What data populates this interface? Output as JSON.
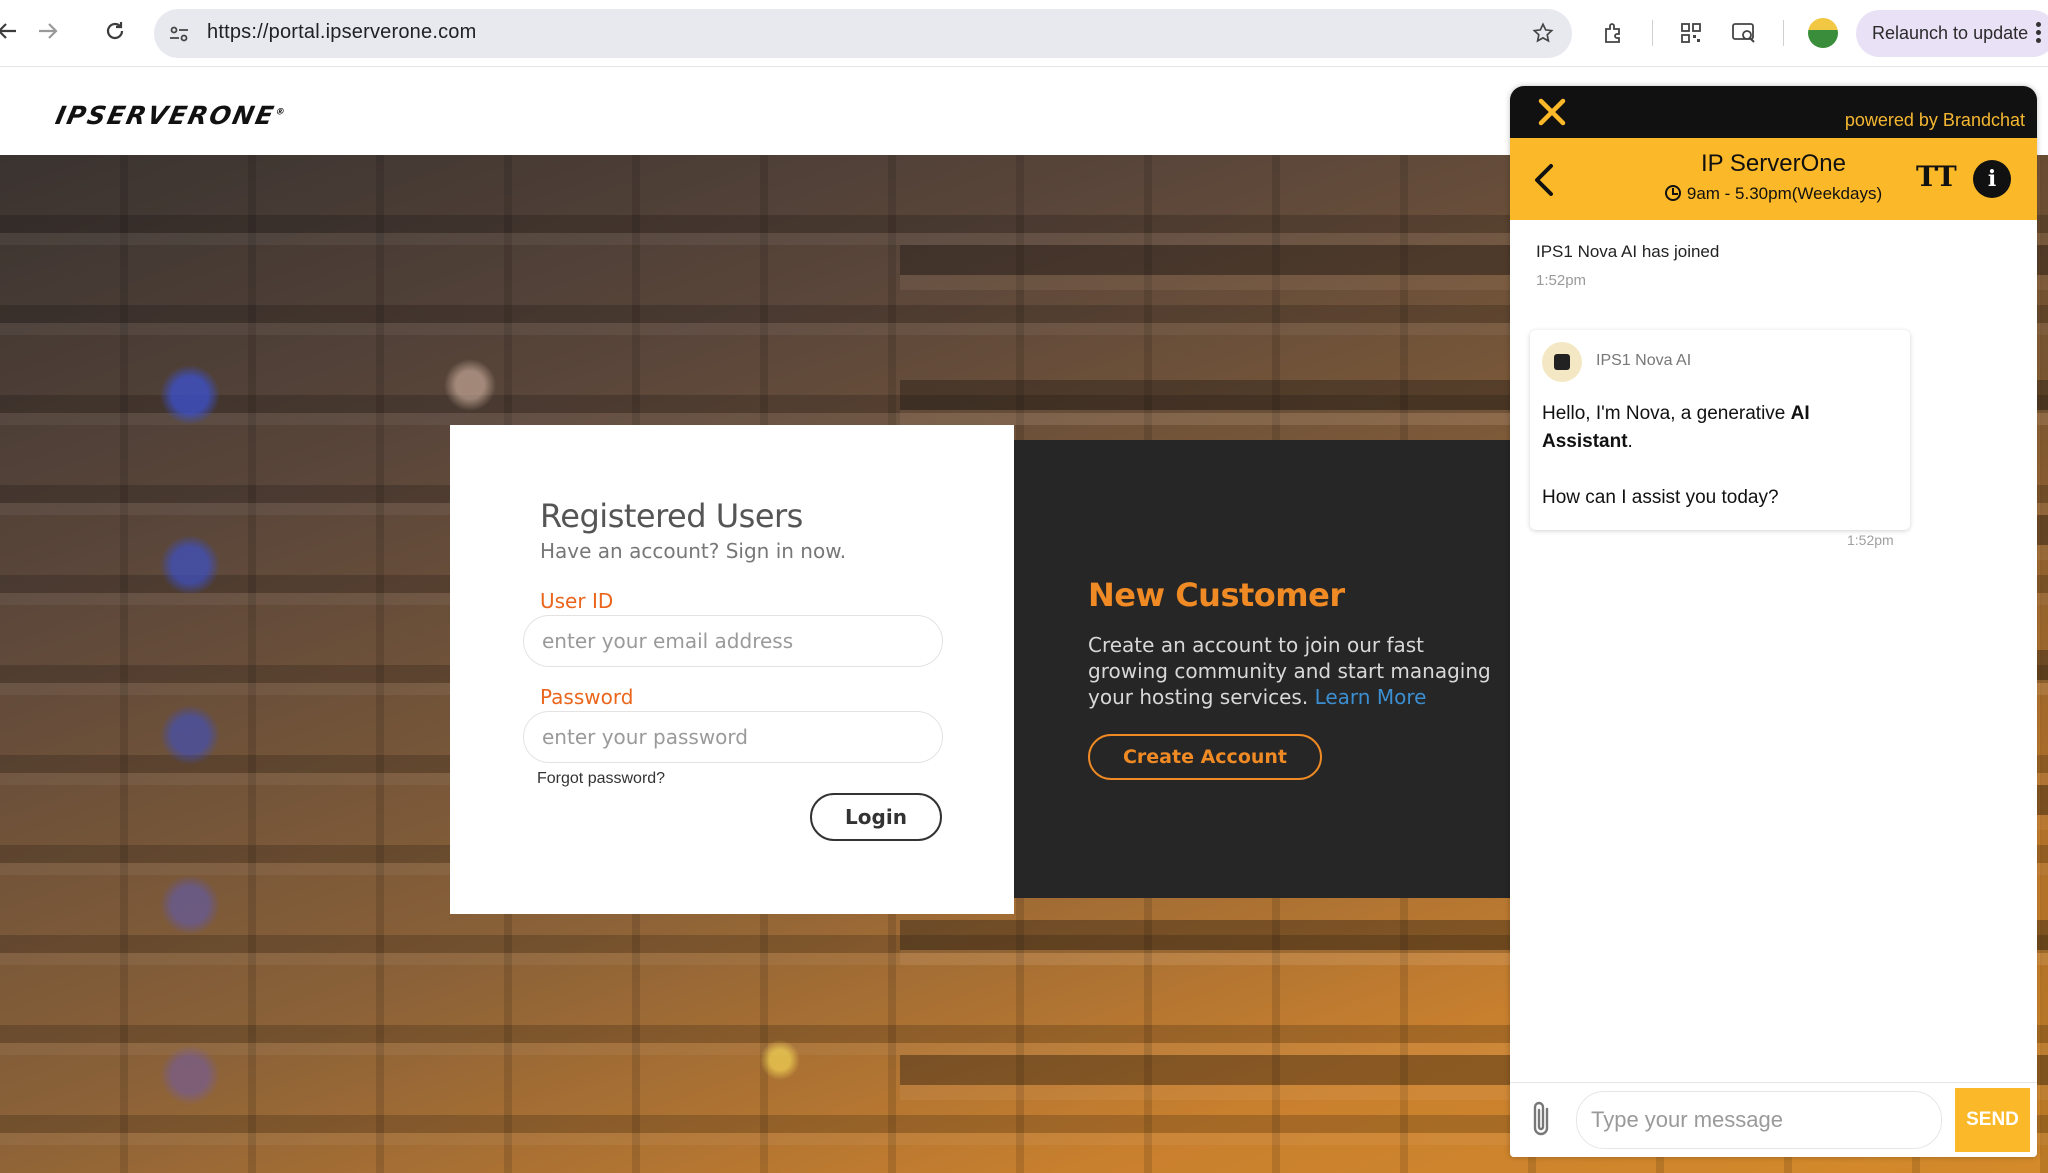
{
  "browser": {
    "url": "https://portal.ipserverone.com",
    "relaunch_label": "Relaunch to update"
  },
  "site": {
    "logo_text": "IPSERVERONE"
  },
  "login": {
    "title": "Registered Users",
    "subtitle": "Have an account? Sign in now.",
    "user_label": "User ID",
    "user_placeholder": "enter your email address",
    "password_label": "Password",
    "password_placeholder": "enter your password",
    "forgot": "Forgot password?",
    "login_button": "Login"
  },
  "new_customer": {
    "title": "New Customer",
    "text": "Create an account to join our fast growing community and start managing your hosting services.",
    "learn_more": "Learn More",
    "create_button": "Create Account"
  },
  "chat": {
    "powered_by": "powered by Brandchat",
    "name": "IP ServerOne",
    "hours": "9am - 5.30pm(Weekdays)",
    "font_icon_text": "TT",
    "joined_text": "IPS1 Nova AI has joined",
    "joined_time": "1:52pm",
    "bot_name": "IPS1 Nova AI",
    "message_intro": "Hello, I'm Nova, a generative",
    "message_bold": "AI Assistant",
    "message_end": ".",
    "message_question": "How can I assist you today?",
    "message_time": "1:52pm",
    "input_placeholder": "Type your message",
    "send_label": "SEND"
  },
  "colors": {
    "accent_orange": "#e9661c",
    "chat_yellow": "#fbb828",
    "link_blue": "#3b8ed0"
  },
  "icons": [
    "back-arrow-icon",
    "forward-arrow-icon",
    "reload-icon",
    "site-info-icon",
    "star-icon",
    "extensions-icon",
    "qr-code-icon",
    "cast-search-icon",
    "profile-avatar",
    "kebab-menu-icon",
    "close-icon",
    "chevron-left-icon",
    "clock-icon",
    "font-size-icon",
    "info-icon",
    "paperclip-icon"
  ]
}
